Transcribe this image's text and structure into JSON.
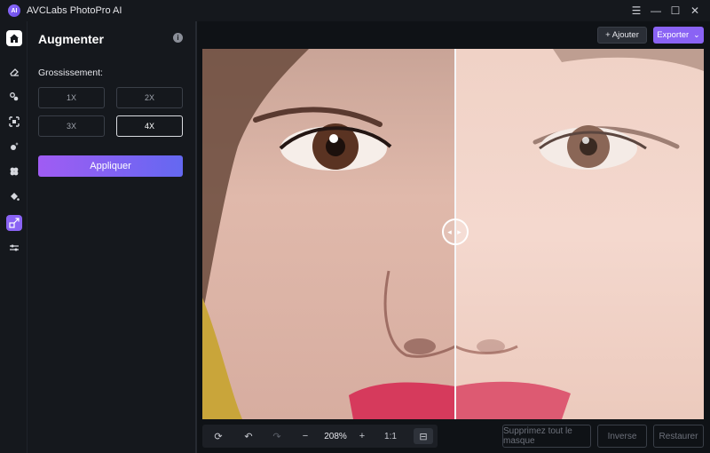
{
  "window": {
    "title": "AVCLabs PhotoPro AI",
    "logo_letters": "AI"
  },
  "window_controls": {
    "menu": "☰",
    "minimize": "—",
    "maximize": "☐",
    "close": "✕"
  },
  "rail": {
    "icons": [
      "home-icon",
      "eraser-icon",
      "face-swap-icon",
      "enlarge-icon",
      "retouch-icon",
      "replace-icon",
      "colorize-icon",
      "upscale-icon",
      "adjust-icon"
    ],
    "active": "upscale-icon"
  },
  "panel": {
    "title": "Augmenter",
    "info_glyph": "i",
    "section_label": "Grossissement:",
    "scale_options": [
      "1X",
      "2X",
      "3X",
      "4X"
    ],
    "selected_scale": "4X",
    "apply_label": "Appliquer"
  },
  "topbar": {
    "add_label": "+ Ajouter",
    "export_label": "Exporter",
    "export_arrow": "⌄"
  },
  "viewer": {
    "compare_handle": "◂ ▸"
  },
  "bottom_tools": {
    "reset_icon": "⟳",
    "undo_icon": "↶",
    "redo_icon": "↷",
    "zoom_out": "−",
    "zoom_level": "208%",
    "zoom_in": "+",
    "actual_size": "1:1",
    "compare_icon": "⊟"
  },
  "footer": {
    "remove_mask": "Supprimez tout le masque",
    "invert": "Inverse",
    "restore": "Restaurer"
  },
  "colors": {
    "accent": "#8a63f4",
    "background": "#0f1216",
    "panel": "#15181d"
  }
}
